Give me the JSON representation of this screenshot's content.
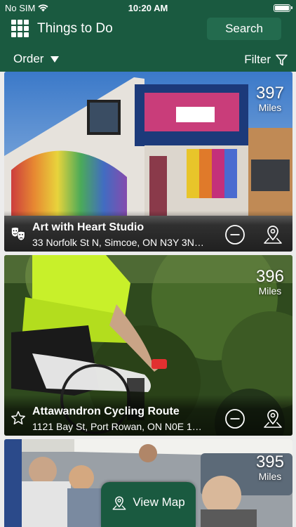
{
  "status_bar": {
    "carrier": "No SIM",
    "time": "10:20 AM",
    "wifi_icon": "wifi-icon",
    "battery_icon": "battery-icon"
  },
  "header": {
    "menu_icon": "grid-menu-icon",
    "title": "Things to Do",
    "search_label": "Search"
  },
  "toolbar": {
    "order_label": "Order",
    "filter_label": "Filter"
  },
  "cards": [
    {
      "name": "Art with Heart Studio",
      "address": "33 Norfolk St N, Simcoe, ON N3Y 3N…",
      "distance": "397",
      "unit": "Miles",
      "category_icon": "theater-masks-icon"
    },
    {
      "name": "Attawandron Cycling Route",
      "address": "1121 Bay St, Port Rowan, ON N0E 1…",
      "distance": "396",
      "unit": "Miles",
      "category_icon": "star-outline-icon"
    },
    {
      "distance": "395",
      "unit": "Miles"
    }
  ],
  "view_map": {
    "label": "View Map"
  },
  "colors": {
    "brand_green": "#1a5a40",
    "button_green": "#236b4e"
  }
}
